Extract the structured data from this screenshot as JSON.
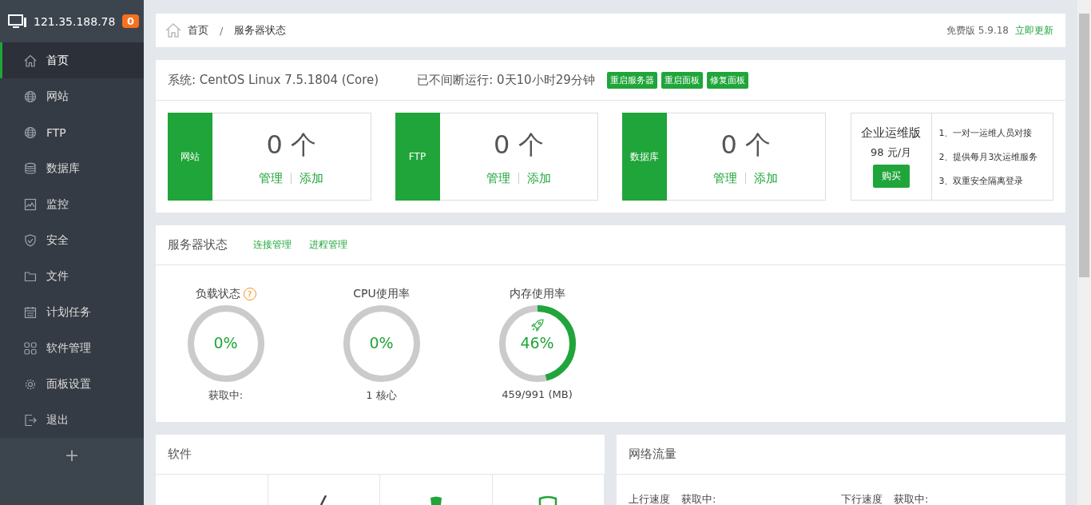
{
  "sidebar": {
    "host": "121.35.188.78",
    "badge": "0",
    "items": [
      {
        "label": "首页",
        "selected": true
      },
      {
        "label": "网站",
        "selected": false
      },
      {
        "label": "FTP",
        "selected": false
      },
      {
        "label": "数据库",
        "selected": false
      },
      {
        "label": "监控",
        "selected": false
      },
      {
        "label": "安全",
        "selected": false
      },
      {
        "label": "文件",
        "selected": false
      },
      {
        "label": "计划任务",
        "selected": false
      },
      {
        "label": "软件管理",
        "selected": false
      },
      {
        "label": "面板设置",
        "selected": false
      },
      {
        "label": "退出",
        "selected": false
      }
    ],
    "add": "+"
  },
  "breadcrumb": {
    "items": [
      "首页",
      "服务器状态"
    ],
    "separator": "/",
    "version": "免费版 5.9.18",
    "update": "立即更新"
  },
  "system": {
    "os": "系统: CentOS Linux 7.5.1804 (Core)",
    "uptime": "已不间断运行: 0天10小时29分钟",
    "actions": [
      "重启服务器",
      "重启面板",
      "修复面板"
    ]
  },
  "stats": [
    {
      "label": "网站",
      "count": "0 个",
      "links": [
        "管理",
        "添加"
      ]
    },
    {
      "label": "FTP",
      "count": "0 个",
      "links": [
        "管理",
        "添加"
      ]
    },
    {
      "label": "数据库",
      "count": "0 个",
      "links": [
        "管理",
        "添加"
      ]
    }
  ],
  "enterprise": {
    "title": "企业运维版",
    "price": "98 元/月",
    "button": "购买",
    "features": [
      "1、一对一运维人员对接",
      "2、提供每月3次运维服务",
      "3、双重安全隔离登录"
    ]
  },
  "server_status": {
    "title": "服务器状态",
    "links": [
      "连接管理",
      "进程管理"
    ],
    "gauges": [
      {
        "title": "负载状态",
        "help": "?",
        "level": 0,
        "reading": "0%",
        "detail": "获取中:"
      },
      {
        "title": "CPU使用率",
        "level": 0,
        "reading": "0%",
        "detail": "1 核心"
      },
      {
        "title": "内存使用率",
        "level": 0.46,
        "reading": "46%",
        "detail": "459/991 (MB)"
      }
    ]
  },
  "software": {
    "title": "软件"
  },
  "network": {
    "title": "网络流量",
    "up_label": "上行速度",
    "up_value": "获取中:",
    "down_label": "下行速度",
    "down_value": "获取中:"
  }
}
